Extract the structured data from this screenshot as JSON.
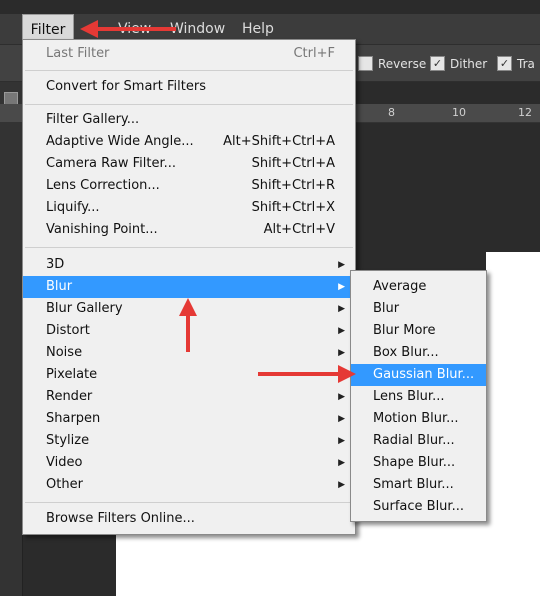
{
  "menubar": {
    "items": [
      "Filter",
      "View",
      "Window",
      "Help"
    ]
  },
  "options": {
    "reverse": "Reverse",
    "dither": "Dither",
    "transparency": "Tra"
  },
  "ruler": {
    "ticks": [
      "8",
      "10",
      "12"
    ]
  },
  "filter_menu": {
    "last_filter": {
      "label": "Last Filter",
      "shortcut": "Ctrl+F"
    },
    "convert_smart": "Convert for Smart Filters",
    "filter_gallery": "Filter Gallery...",
    "adaptive_wide": {
      "label": "Adaptive Wide Angle...",
      "shortcut": "Alt+Shift+Ctrl+A"
    },
    "camera_raw": {
      "label": "Camera Raw Filter...",
      "shortcut": "Shift+Ctrl+A"
    },
    "lens_correction": {
      "label": "Lens Correction...",
      "shortcut": "Shift+Ctrl+R"
    },
    "liquify": {
      "label": "Liquify...",
      "shortcut": "Shift+Ctrl+X"
    },
    "vanishing_point": {
      "label": "Vanishing Point...",
      "shortcut": "Alt+Ctrl+V"
    },
    "submenus": [
      "3D",
      "Blur",
      "Blur Gallery",
      "Distort",
      "Noise",
      "Pixelate",
      "Render",
      "Sharpen",
      "Stylize",
      "Video",
      "Other"
    ],
    "browse_online": "Browse Filters Online..."
  },
  "blur_submenu": {
    "items": [
      "Average",
      "Blur",
      "Blur More",
      "Box Blur...",
      "Gaussian Blur...",
      "Lens Blur...",
      "Motion Blur...",
      "Radial Blur...",
      "Shape Blur...",
      "Smart Blur...",
      "Surface Blur..."
    ],
    "highlighted": "Gaussian Blur..."
  },
  "colors": {
    "highlight": "#3399ff",
    "arrow": "#e53935",
    "menu_bg": "#f0f0f0"
  }
}
